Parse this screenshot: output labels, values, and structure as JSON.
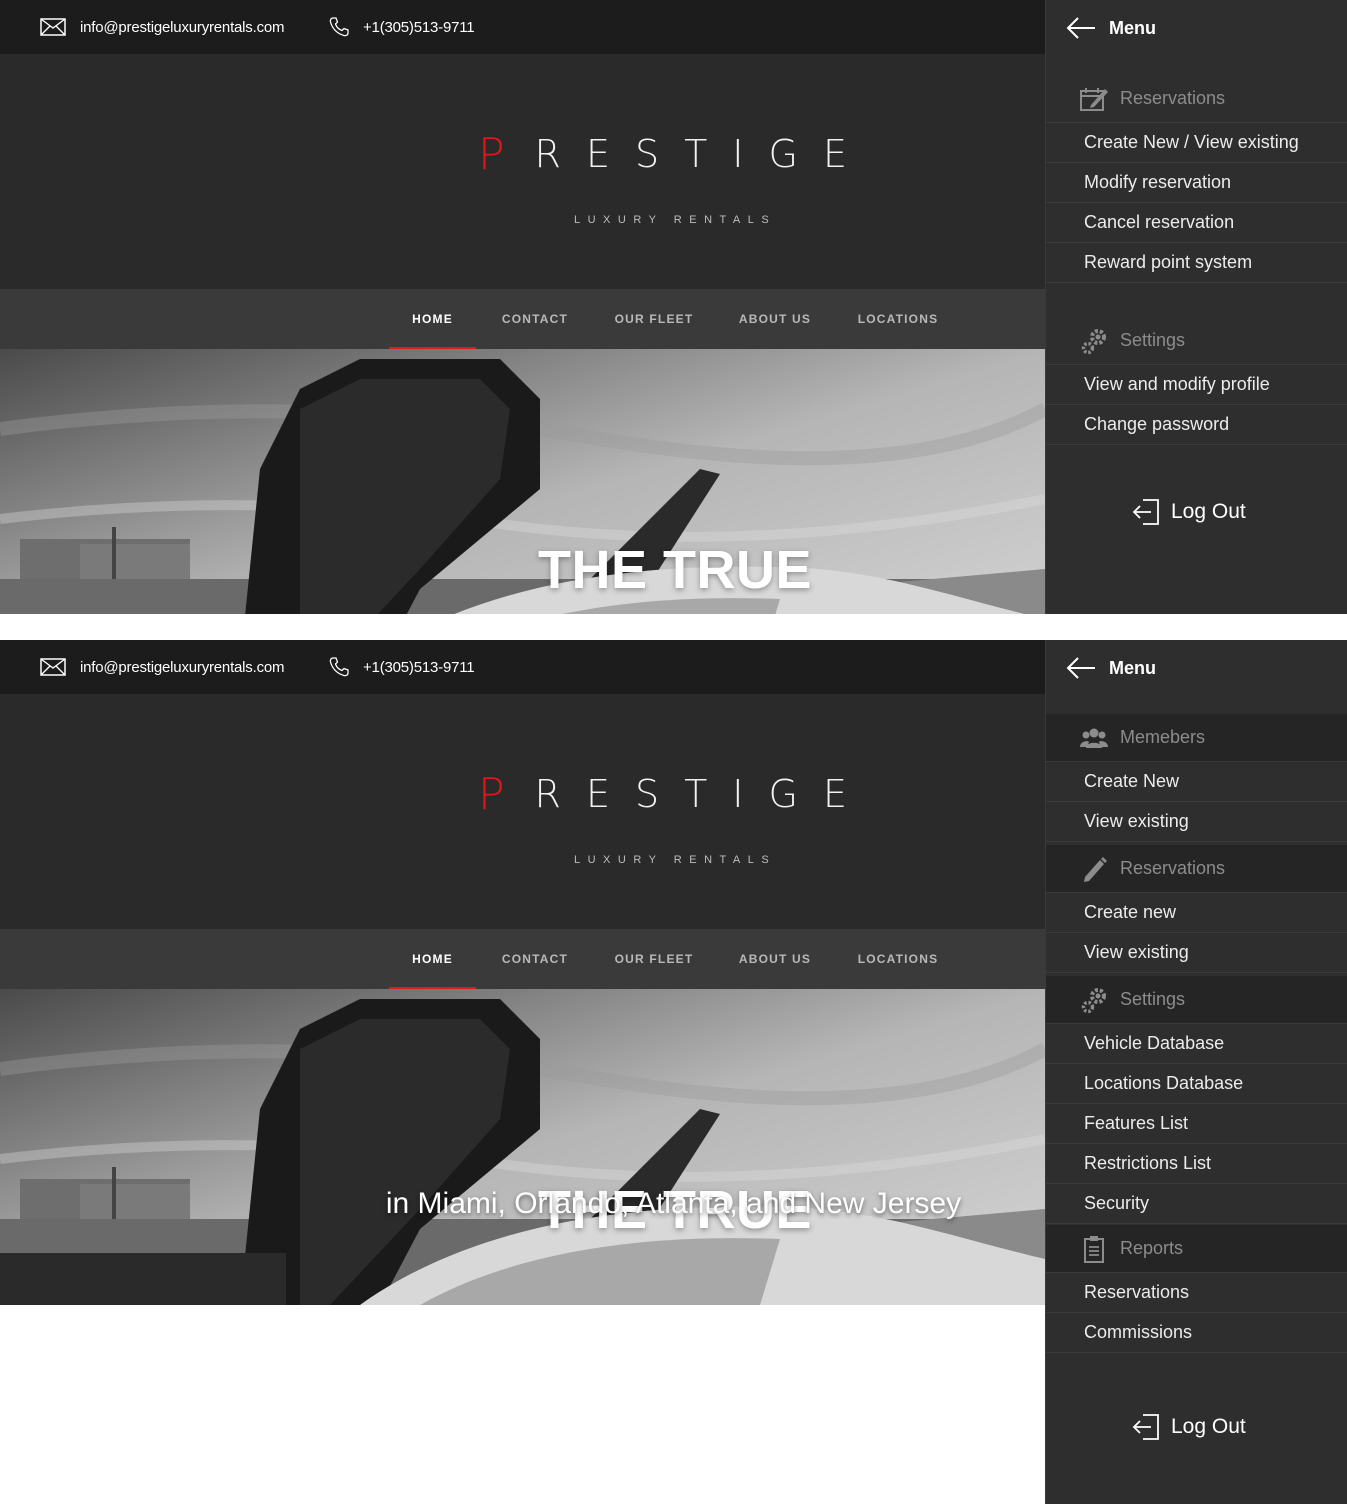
{
  "site": {
    "email": "info@prestigeluxuryrentals.com",
    "phone": "+1(305)513-9711",
    "logo_first": "P",
    "logo_rest": "RESTIGE",
    "logo_tagline": "LUXURY RENTALS",
    "nav": [
      "HOME",
      "CONTACT",
      "OUR FLEET",
      "ABOUT US",
      "LOCATIONS"
    ],
    "active_nav": "HOME",
    "hero_title": "THE TRUE",
    "hero_subtitle": "in Miami, Orlando, Atlanta, and New Jersey",
    "accent_color": "#e01818"
  },
  "menu1": {
    "title": "Menu",
    "sections": [
      {
        "label": "Reservations",
        "icon": "edit-calendar-icon",
        "items": [
          "Create New / View existing",
          "Modify reservation",
          "Cancel reservation",
          "Reward point system"
        ]
      },
      {
        "label": "Settings",
        "icon": "gears-icon",
        "items": [
          "View and modify profile",
          "Change password"
        ]
      }
    ],
    "logout": "Log Out"
  },
  "menu2": {
    "title": "Menu",
    "sections": [
      {
        "label": "Memebers",
        "icon": "users-icon",
        "items": [
          "Create New",
          "View existing"
        ]
      },
      {
        "label": "Reservations",
        "icon": "pencil-icon",
        "items": [
          "Create new",
          "View existing"
        ]
      },
      {
        "label": "Settings",
        "icon": "gears-icon",
        "items": [
          "Vehicle Database",
          "Locations Database",
          "Features List",
          "Restrictions List",
          "Security"
        ]
      },
      {
        "label": "Reports",
        "icon": "clipboard-icon",
        "items": [
          "Reservations",
          "Commissions"
        ]
      }
    ],
    "logout": "Log Out"
  }
}
